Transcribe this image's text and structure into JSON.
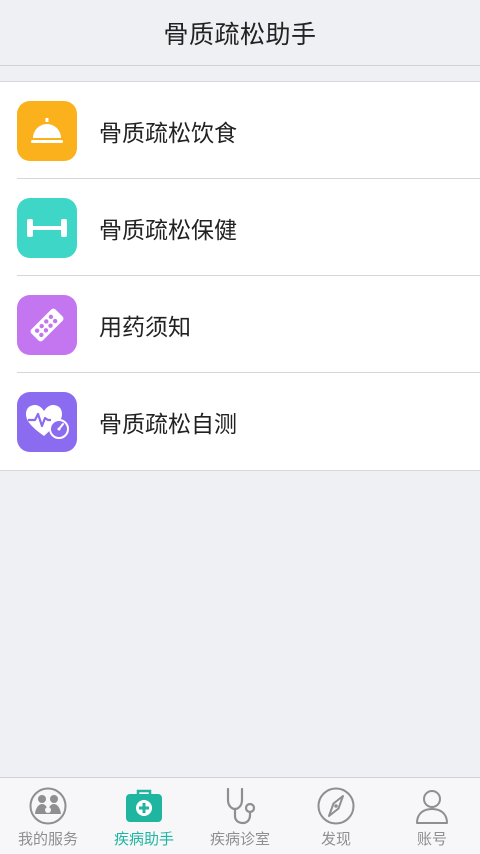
{
  "header": {
    "title": "骨质疏松助手"
  },
  "menu": {
    "items": [
      {
        "label": "骨质疏松饮食",
        "icon": "cloche-icon",
        "color": "#fbb11c"
      },
      {
        "label": "骨质疏松保健",
        "icon": "dumbbell-icon",
        "color": "#3ed6c6"
      },
      {
        "label": "用药须知",
        "icon": "pill-strip-icon",
        "color": "#c376ef"
      },
      {
        "label": "骨质疏松自测",
        "icon": "heart-pulse-gauge-icon",
        "color": "#8b6cf0"
      }
    ]
  },
  "tabbar": {
    "items": [
      {
        "label": "我的服务",
        "icon": "family-icon",
        "active": false
      },
      {
        "label": "疾病助手",
        "icon": "medical-kit-icon",
        "active": true
      },
      {
        "label": "疾病诊室",
        "icon": "stethoscope-icon",
        "active": false
      },
      {
        "label": "发现",
        "icon": "compass-icon",
        "active": false
      },
      {
        "label": "账号",
        "icon": "user-icon",
        "active": false
      }
    ],
    "active_color": "#1fb5a0",
    "inactive_color": "#8e8e93"
  }
}
